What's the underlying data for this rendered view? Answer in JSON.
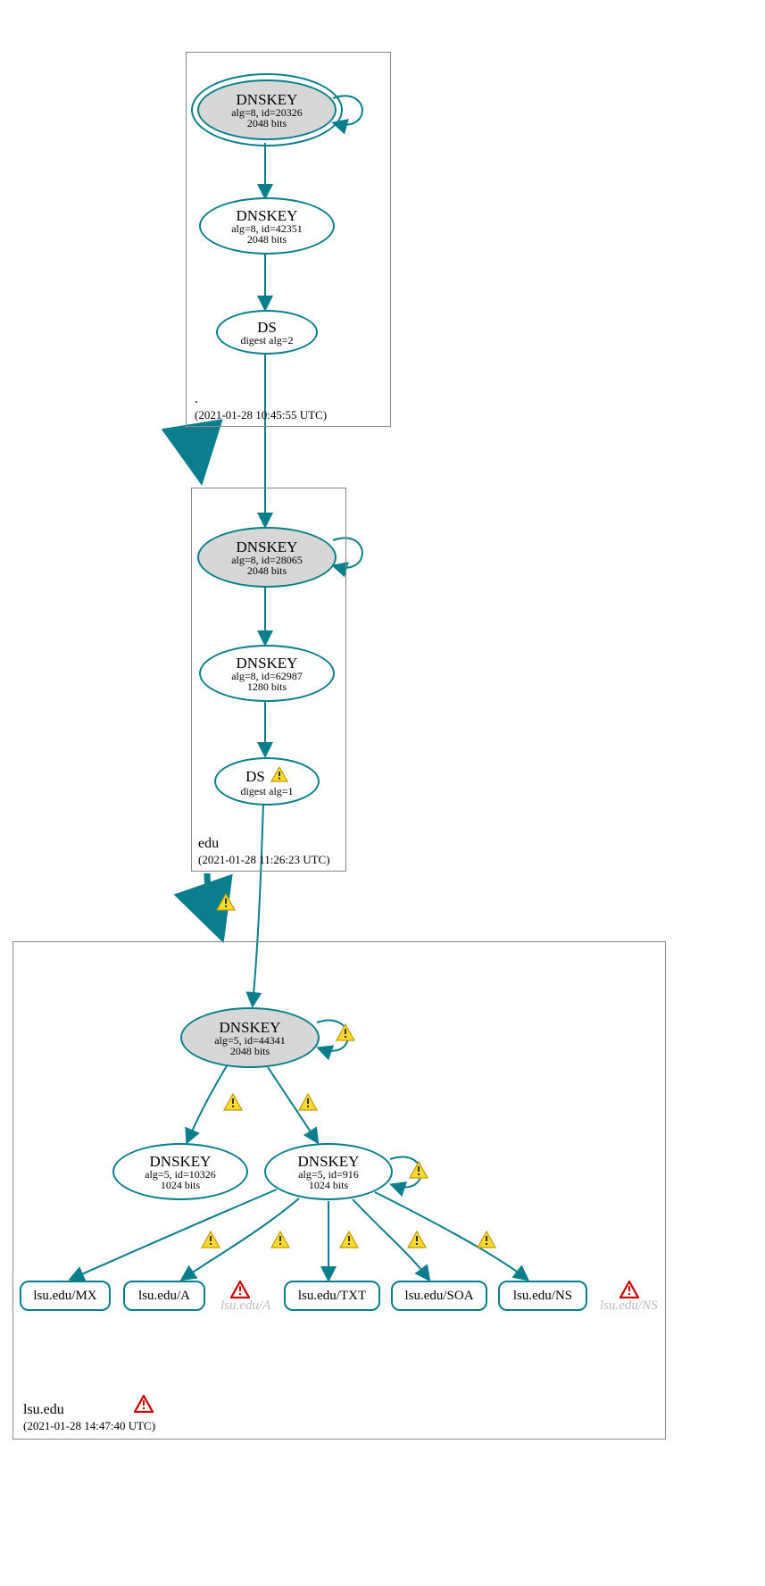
{
  "zones": {
    "root": {
      "name": ".",
      "ts": "(2021-01-28 10:45:55 UTC)"
    },
    "edu": {
      "name": "edu",
      "ts": "(2021-01-28 11:26:23 UTC)"
    },
    "lsu": {
      "name": "lsu.edu",
      "ts": "(2021-01-28 14:47:40 UTC)"
    }
  },
  "nodes": {
    "root_ksk": {
      "title": "DNSKEY",
      "alg": "alg=8, id=20326",
      "bits": "2048 bits"
    },
    "root_zsk": {
      "title": "DNSKEY",
      "alg": "alg=8, id=42351",
      "bits": "2048 bits"
    },
    "root_ds": {
      "title": "DS",
      "alg": "digest alg=2"
    },
    "edu_ksk": {
      "title": "DNSKEY",
      "alg": "alg=8, id=28065",
      "bits": "2048 bits"
    },
    "edu_zsk": {
      "title": "DNSKEY",
      "alg": "alg=8, id=62987",
      "bits": "1280 bits"
    },
    "edu_ds": {
      "title": "DS",
      "alg": "digest alg=1"
    },
    "lsu_ksk": {
      "title": "DNSKEY",
      "alg": "alg=5, id=44341",
      "bits": "2048 bits"
    },
    "lsu_zsk1": {
      "title": "DNSKEY",
      "alg": "alg=5, id=10326",
      "bits": "1024 bits"
    },
    "lsu_zsk2": {
      "title": "DNSKEY",
      "alg": "alg=5, id=916",
      "bits": "1024 bits"
    },
    "rr_mx": {
      "label": "lsu.edu/MX"
    },
    "rr_a": {
      "label": "lsu.edu/A"
    },
    "rr_txt": {
      "label": "lsu.edu/TXT"
    },
    "rr_soa": {
      "label": "lsu.edu/SOA"
    },
    "rr_ns": {
      "label": "lsu.edu/NS"
    },
    "ghost_a": {
      "label": "lsu.edu/A"
    },
    "ghost_ns": {
      "label": "lsu.edu/NS"
    }
  }
}
